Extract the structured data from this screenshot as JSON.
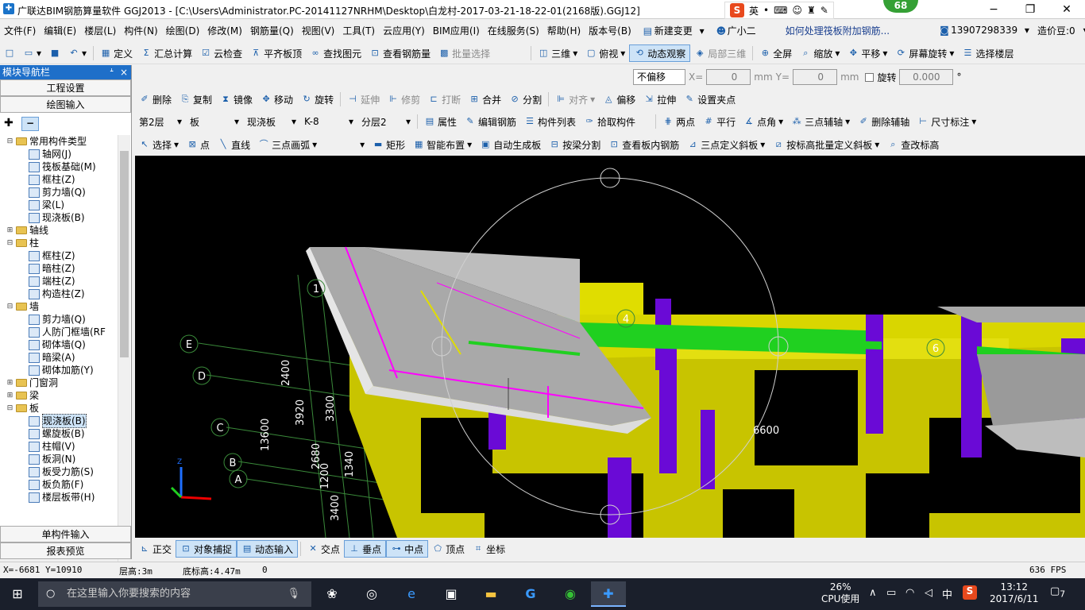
{
  "window": {
    "title": "广联达BIM钢筋算量软件 GGJ2013 - [C:\\Users\\Administrator.PC-20141127NRHM\\Desktop\\白龙村-2017-03-21-18-22-01(2168版).GGJ12]",
    "minimize": "−",
    "maximize": "❐",
    "close": "✕"
  },
  "ime": {
    "logo": "S",
    "lang": "英"
  },
  "badge": "68",
  "menu": {
    "items": [
      "文件(F)",
      "编辑(E)",
      "楼层(L)",
      "构件(N)",
      "绘图(D)",
      "修改(M)",
      "钢筋量(Q)",
      "视图(V)",
      "工具(T)",
      "云应用(Y)",
      "BIM应用(I)",
      "在线服务(S)",
      "帮助(H)",
      "版本号(B)"
    ],
    "new_change": "新建变更",
    "assistant": "广小二",
    "help_link": "如何处理筏板附加钢筋...",
    "phone": "13907298339",
    "bean": "造价豆:0"
  },
  "toolbar1": {
    "define": "定义",
    "sum": "汇总计算",
    "cloud_check": "云检查",
    "align_top": "平齐板顶",
    "find": "查找图元",
    "view_rebar": "查看钢筋量",
    "batch_select": "批量选择",
    "view3d": "三维",
    "top_view": "俯视",
    "dynamic_view": "动态观察",
    "local3d": "局部三维",
    "fullscreen": "全屏",
    "zoom": "缩放",
    "pan": "平移",
    "rotate_screen": "屏幕旋转",
    "select_floor": "选择楼层"
  },
  "nav": {
    "title": "模块导航栏",
    "pin": "ᗮ",
    "close": "×",
    "project_settings": "工程设置",
    "drawing_input": "绘图输入",
    "single_input": "单构件输入",
    "report_preview": "报表预览",
    "tree": [
      {
        "label": "常用构件类型",
        "level": 0,
        "type": "folder",
        "exp": "⊟"
      },
      {
        "label": "轴网(J)",
        "level": 1,
        "type": "leaf"
      },
      {
        "label": "筏板基础(M)",
        "level": 1,
        "type": "leaf"
      },
      {
        "label": "框柱(Z)",
        "level": 1,
        "type": "leaf"
      },
      {
        "label": "剪力墙(Q)",
        "level": 1,
        "type": "leaf"
      },
      {
        "label": "梁(L)",
        "level": 1,
        "type": "leaf"
      },
      {
        "label": "现浇板(B)",
        "level": 1,
        "type": "leaf"
      },
      {
        "label": "轴线",
        "level": 0,
        "type": "folder",
        "exp": "⊞"
      },
      {
        "label": "柱",
        "level": 0,
        "type": "folder",
        "exp": "⊟"
      },
      {
        "label": "框柱(Z)",
        "level": 1,
        "type": "leaf"
      },
      {
        "label": "暗柱(Z)",
        "level": 1,
        "type": "leaf"
      },
      {
        "label": "端柱(Z)",
        "level": 1,
        "type": "leaf"
      },
      {
        "label": "构造柱(Z)",
        "level": 1,
        "type": "leaf"
      },
      {
        "label": "墙",
        "level": 0,
        "type": "folder",
        "exp": "⊟"
      },
      {
        "label": "剪力墙(Q)",
        "level": 1,
        "type": "leaf"
      },
      {
        "label": "人防门框墙(RF",
        "level": 1,
        "type": "leaf"
      },
      {
        "label": "砌体墙(Q)",
        "level": 1,
        "type": "leaf"
      },
      {
        "label": "暗梁(A)",
        "level": 1,
        "type": "leaf"
      },
      {
        "label": "砌体加筋(Y)",
        "level": 1,
        "type": "leaf"
      },
      {
        "label": "门窗洞",
        "level": 0,
        "type": "folder",
        "exp": "⊞"
      },
      {
        "label": "梁",
        "level": 0,
        "type": "folder",
        "exp": "⊞"
      },
      {
        "label": "板",
        "level": 0,
        "type": "folder",
        "exp": "⊟"
      },
      {
        "label": "现浇板(B)",
        "level": 1,
        "type": "leaf",
        "selected": true
      },
      {
        "label": "螺旋板(B)",
        "level": 1,
        "type": "leaf"
      },
      {
        "label": "柱帽(V)",
        "level": 1,
        "type": "leaf"
      },
      {
        "label": "板洞(N)",
        "level": 1,
        "type": "leaf"
      },
      {
        "label": "板受力筋(S)",
        "level": 1,
        "type": "leaf"
      },
      {
        "label": "板负筋(F)",
        "level": 1,
        "type": "leaf"
      },
      {
        "label": "楼层板带(H)",
        "level": 1,
        "type": "leaf"
      }
    ]
  },
  "props": {
    "offset": "不偏移",
    "x_label": "X=",
    "x_val": "0",
    "y_label": "Y=",
    "y_val": "0",
    "unit": "mm",
    "rotate": "旋转",
    "rot_val": "0.000",
    "deg": "°"
  },
  "edit_toolbar": [
    "删除",
    "复制",
    "镜像",
    "移动",
    "旋转",
    "延伸",
    "修剪",
    "打断",
    "合并",
    "分割",
    "对齐",
    "偏移",
    "拉伸",
    "设置夹点"
  ],
  "layer_toolbar": {
    "floor": "第2层",
    "type": "板",
    "subtype": "现浇板",
    "name": "K-8",
    "layer": "分层2",
    "attr": "属性",
    "edit_rebar": "编辑钢筋",
    "comp_list": "构件列表",
    "pick": "拾取构件",
    "two_points": "两点",
    "parallel": "平行",
    "angle": "点角",
    "three_axis": "三点辅轴",
    "delete_axis": "删除辅轴",
    "dimension": "尺寸标注"
  },
  "draw_toolbar": [
    "选择",
    "点",
    "直线",
    "三点画弧",
    "",
    "矩形",
    "智能布置",
    "自动生成板",
    "按梁分割",
    "查看板内钢筋",
    "三点定义斜板",
    "按标高批量定义斜板",
    "查改标高"
  ],
  "canvas": {
    "axis_labels": [
      "1",
      "4",
      "6",
      "E",
      "D",
      "C",
      "B",
      "A"
    ],
    "dims": [
      "2400",
      "3920",
      "3300",
      "13600",
      "2680",
      "1340",
      "1200",
      "3400",
      "6600"
    ]
  },
  "bottom_toolbar": [
    "正交",
    "对象捕捉",
    "动态输入",
    "交点",
    "垂点",
    "中点",
    "顶点",
    "坐标"
  ],
  "status": {
    "coords": "X=-6681 Y=10910",
    "floor_height": "层高:3m",
    "bottom_elev": "底标高:4.47m",
    "num": "0",
    "fps": "636 FPS"
  },
  "taskbar": {
    "search": "在这里输入你要搜索的内容",
    "cpu": "26%",
    "cpu_label": "CPU使用",
    "time": "13:12",
    "date": "2017/6/11",
    "ime_lang": "中",
    "notif": "7"
  }
}
